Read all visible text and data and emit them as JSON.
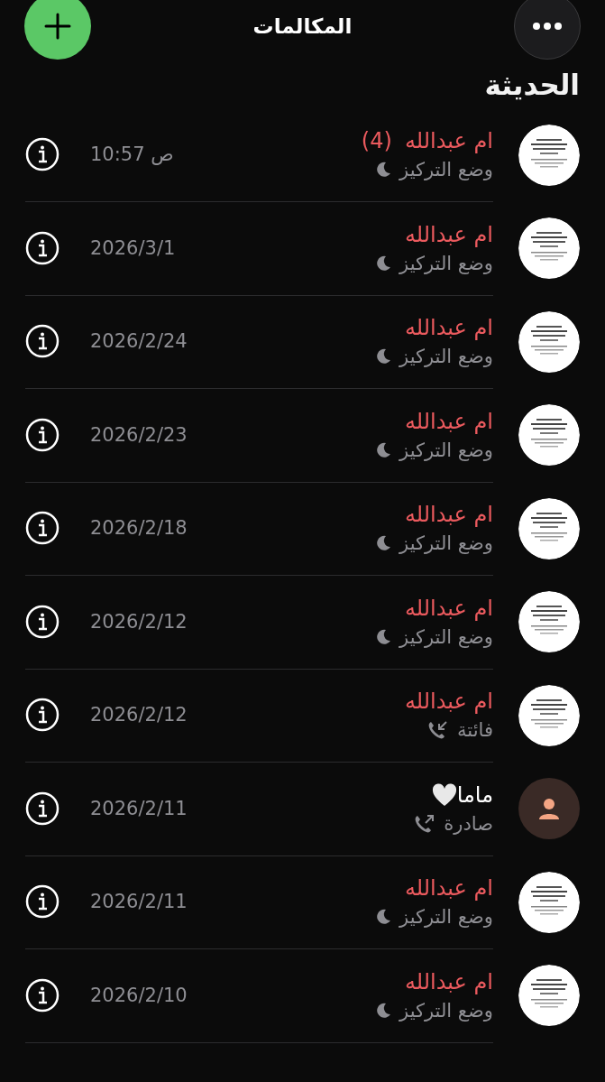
{
  "header": {
    "title": "المكالمات"
  },
  "section_title": "الحديثة",
  "calls": [
    {
      "name": "ام عبدالله",
      "missed": true,
      "count": "(4)",
      "detail": "وضع التركيز",
      "kind": "focus",
      "time": "10:57 ص",
      "photo": true
    },
    {
      "name": "ام عبدالله",
      "missed": true,
      "detail": "وضع التركيز",
      "kind": "focus",
      "time": "2026/3/1",
      "photo": true
    },
    {
      "name": "ام عبدالله",
      "missed": true,
      "detail": "وضع التركيز",
      "kind": "focus",
      "time": "2026/2/24",
      "photo": true
    },
    {
      "name": "ام عبدالله",
      "missed": true,
      "detail": "وضع التركيز",
      "kind": "focus",
      "time": "2026/2/23",
      "photo": true
    },
    {
      "name": "ام عبدالله",
      "missed": true,
      "detail": "وضع التركيز",
      "kind": "focus",
      "time": "2026/2/18",
      "photo": true
    },
    {
      "name": "ام عبدالله",
      "missed": true,
      "detail": "وضع التركيز",
      "kind": "focus",
      "time": "2026/2/12",
      "photo": true
    },
    {
      "name": "ام عبدالله",
      "missed": true,
      "detail": "فائتة",
      "kind": "missed",
      "time": "2026/2/12",
      "photo": true
    },
    {
      "name": "ماما",
      "missed": false,
      "heart": true,
      "detail": "صادرة",
      "kind": "outgoing",
      "time": "2026/2/11",
      "photo": false
    },
    {
      "name": "ام عبدالله",
      "missed": true,
      "detail": "وضع التركيز",
      "kind": "focus",
      "time": "2026/2/11",
      "photo": true
    },
    {
      "name": "ام عبدالله",
      "missed": true,
      "detail": "وضع التركيز",
      "kind": "focus",
      "time": "2026/2/10",
      "photo": true
    }
  ]
}
